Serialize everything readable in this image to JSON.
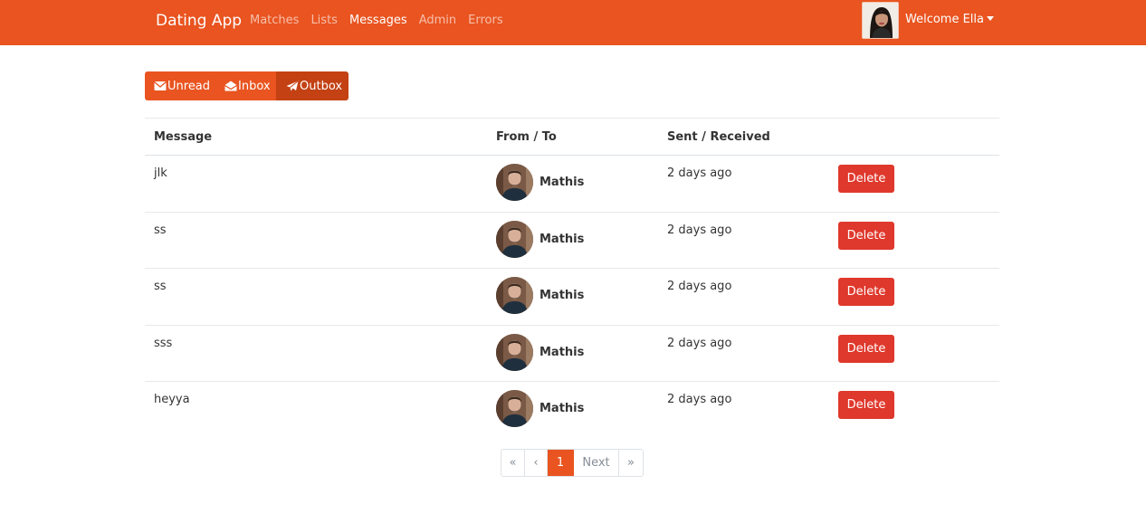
{
  "navbar": {
    "brand": "Dating App",
    "links": [
      "Matches",
      "Lists",
      "Messages",
      "Admin",
      "Errors"
    ],
    "active_link": "Messages",
    "welcome": "Welcome Ella",
    "color": "#e95420"
  },
  "tabs": {
    "unread": "Unread",
    "inbox": "Inbox",
    "outbox": "Outbox",
    "active": "Outbox"
  },
  "table": {
    "headers": [
      "Message",
      "From / To",
      "Sent / Received"
    ],
    "rows": [
      {
        "message": "jlk",
        "user": "Mathis",
        "time": "2 days ago",
        "action": "Delete"
      },
      {
        "message": "ss",
        "user": "Mathis",
        "time": "2 days ago",
        "action": "Delete"
      },
      {
        "message": "ss",
        "user": "Mathis",
        "time": "2 days ago",
        "action": "Delete"
      },
      {
        "message": "sss",
        "user": "Mathis",
        "time": "2 days ago",
        "action": "Delete"
      },
      {
        "message": "heyya",
        "user": "Mathis",
        "time": "2 days ago",
        "action": "Delete"
      }
    ]
  },
  "pagination": {
    "first": "«",
    "prev": "‹",
    "current": "1",
    "next": "Next",
    "last": "»"
  },
  "colors": {
    "primary": "#e95420",
    "active_tab": "#c34113",
    "danger": "#df382c"
  }
}
